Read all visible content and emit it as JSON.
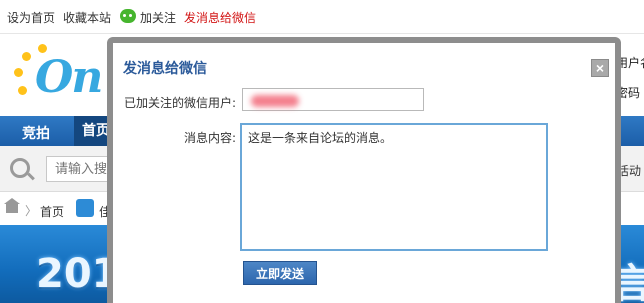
{
  "topbar": {
    "set_homepage": "设为首页",
    "bookmark": "收藏本站",
    "follow": "加关注",
    "send_wechat": "发消息给微信"
  },
  "header": {
    "logo_text": "On",
    "user_label": "用户名",
    "password_label": "密码"
  },
  "nav": {
    "items": [
      "竞拍",
      "首页"
    ]
  },
  "search": {
    "placeholder": "请输入搜索",
    "activity_label": "活动"
  },
  "breadcrumb": {
    "home": "首页",
    "forum": "佳蓝"
  },
  "banner": {
    "text": "201",
    "right_text": "言"
  },
  "dialog": {
    "title": "发消息给微信",
    "close_label": "×",
    "followed_user_label": "已加关注的微信用户:",
    "followed_user_value": "",
    "message_label": "消息内容:",
    "message_value": "这是一条来自论坛的消息。",
    "send_button": "立即发送"
  },
  "colors": {
    "accent_blue": "#1c5ea8",
    "dialog_title": "#2b5a9a",
    "link_red": "#d21414",
    "wechat_green": "#46b52e"
  }
}
